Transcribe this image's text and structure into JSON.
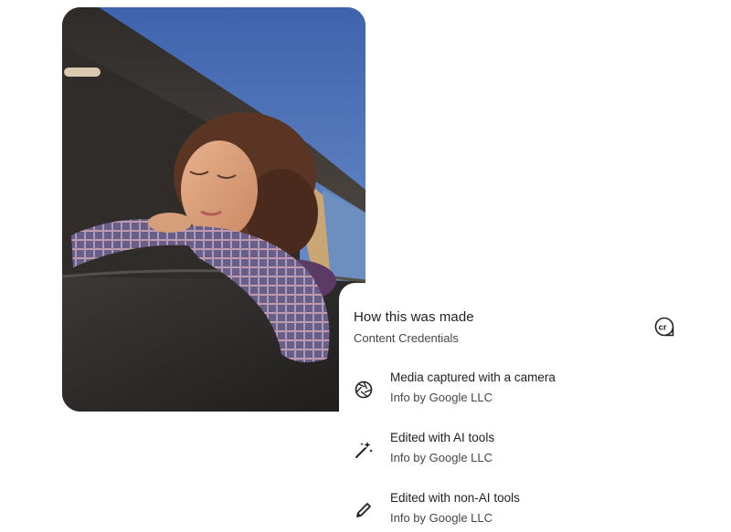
{
  "panel": {
    "title": "How this was made",
    "subtitle": "Content Credentials",
    "badge_icon": "content-credentials-cr-icon",
    "items": [
      {
        "icon": "camera-shutter-icon",
        "title": "Media captured with a camera",
        "source": "Info by Google LLC"
      },
      {
        "icon": "magic-wand-icon",
        "title": "Edited with AI tools",
        "source": "Info by Google LLC"
      },
      {
        "icon": "pencil-icon",
        "title": "Edited with non-AI tools",
        "source": "Info by Google LLC"
      }
    ]
  },
  "colors": {
    "background": "#ffffff",
    "primary_text": "#1f1f1f",
    "secondary_text": "#444746",
    "sky": "#4a72b8"
  }
}
